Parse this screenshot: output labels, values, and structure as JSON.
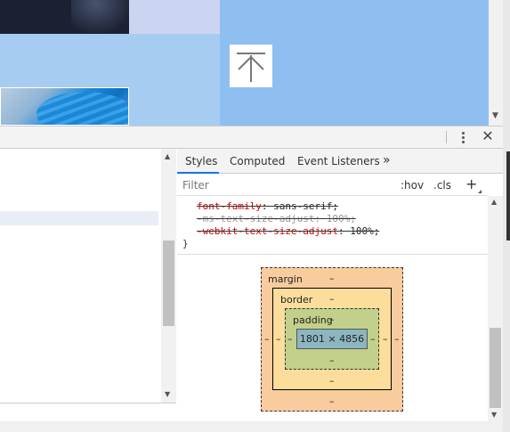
{
  "devtools": {
    "tabs": [
      {
        "label": "Styles",
        "active": true
      },
      {
        "label": "Computed",
        "active": false
      },
      {
        "label": "Event Listeners",
        "active": false
      }
    ],
    "more_tabs_glyph": "»",
    "filter": {
      "placeholder": "Filter",
      "value": ""
    },
    "hov_label": ":hov",
    "cls_label": ".cls",
    "add_rule_glyph": "+",
    "close_glyph": "✕",
    "css_rules": [
      {
        "name": "font-family",
        "value": "sans-serif;",
        "faded": false
      },
      {
        "name": "-ms-text-size-adjust",
        "value": "100%;",
        "faded": true
      },
      {
        "name": "-webkit-text-size-adjust",
        "value": "100%;",
        "faded": false
      }
    ],
    "closing_brace": "}",
    "box_model": {
      "margin_label": "margin",
      "border_label": "border",
      "padding_label": "padding",
      "content_size": "1801 × 4856",
      "empty_value": "–"
    }
  },
  "colors": {
    "accent_tab": "#1a73e8",
    "margin": "#f9cc9d",
    "border": "#fddd9b",
    "padding": "#c3d08b",
    "content": "#8cb6c0",
    "page_background": "#8ebff0"
  }
}
